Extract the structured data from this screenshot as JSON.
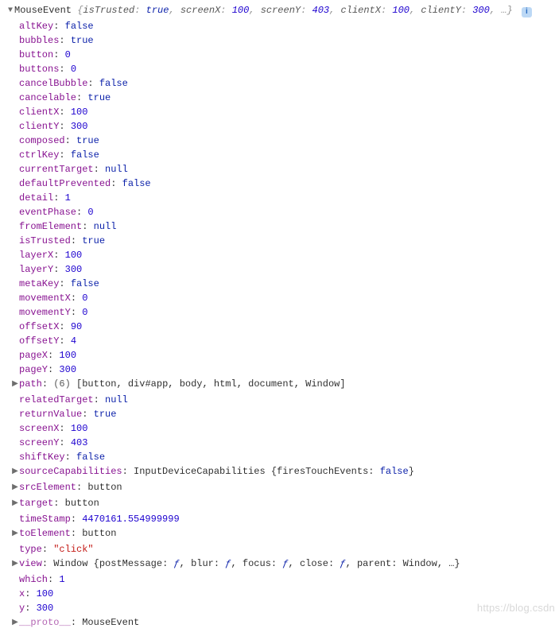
{
  "header": {
    "class_name": "MouseEvent",
    "summary": [
      {
        "k": "isTrusted",
        "v": "true",
        "cls": "bool"
      },
      {
        "k": "screenX",
        "v": "100",
        "cls": "num"
      },
      {
        "k": "screenY",
        "v": "403",
        "cls": "num"
      },
      {
        "k": "clientX",
        "v": "100",
        "cls": "num"
      },
      {
        "k": "clientY",
        "v": "300",
        "cls": "num"
      }
    ],
    "ellipsis": "…"
  },
  "props": [
    {
      "key": "altKey",
      "type": "bool",
      "value": "false"
    },
    {
      "key": "bubbles",
      "type": "bool",
      "value": "true"
    },
    {
      "key": "button",
      "type": "num",
      "value": "0"
    },
    {
      "key": "buttons",
      "type": "num",
      "value": "0"
    },
    {
      "key": "cancelBubble",
      "type": "bool",
      "value": "false"
    },
    {
      "key": "cancelable",
      "type": "bool",
      "value": "true"
    },
    {
      "key": "clientX",
      "type": "num",
      "value": "100"
    },
    {
      "key": "clientY",
      "type": "num",
      "value": "300"
    },
    {
      "key": "composed",
      "type": "bool",
      "value": "true"
    },
    {
      "key": "ctrlKey",
      "type": "bool",
      "value": "false"
    },
    {
      "key": "currentTarget",
      "type": "nul",
      "value": "null"
    },
    {
      "key": "defaultPrevented",
      "type": "bool",
      "value": "false"
    },
    {
      "key": "detail",
      "type": "num",
      "value": "1"
    },
    {
      "key": "eventPhase",
      "type": "num",
      "value": "0"
    },
    {
      "key": "fromElement",
      "type": "nul",
      "value": "null"
    },
    {
      "key": "isTrusted",
      "type": "bool",
      "value": "true"
    },
    {
      "key": "layerX",
      "type": "num",
      "value": "100"
    },
    {
      "key": "layerY",
      "type": "num",
      "value": "300"
    },
    {
      "key": "metaKey",
      "type": "bool",
      "value": "false"
    },
    {
      "key": "movementX",
      "type": "num",
      "value": "0"
    },
    {
      "key": "movementY",
      "type": "num",
      "value": "0"
    },
    {
      "key": "offsetX",
      "type": "num",
      "value": "90"
    },
    {
      "key": "offsetY",
      "type": "num",
      "value": "4"
    },
    {
      "key": "pageX",
      "type": "num",
      "value": "100"
    },
    {
      "key": "pageY",
      "type": "num",
      "value": "300"
    },
    {
      "key": "path",
      "type": "path",
      "expandable": true,
      "count": "(6)",
      "items": [
        "button",
        "div#app",
        "body",
        "html",
        "document",
        "Window"
      ]
    },
    {
      "key": "relatedTarget",
      "type": "nul",
      "value": "null"
    },
    {
      "key": "returnValue",
      "type": "bool",
      "value": "true"
    },
    {
      "key": "screenX",
      "type": "num",
      "value": "100"
    },
    {
      "key": "screenY",
      "type": "num",
      "value": "403"
    },
    {
      "key": "shiftKey",
      "type": "bool",
      "value": "false"
    },
    {
      "key": "sourceCapabilities",
      "type": "caps",
      "expandable": true,
      "class": "InputDeviceCapabilities",
      "inner_key": "firesTouchEvents",
      "inner_val": "false"
    },
    {
      "key": "srcElement",
      "type": "obj",
      "expandable": true,
      "value": "button"
    },
    {
      "key": "target",
      "type": "obj",
      "expandable": true,
      "value": "button"
    },
    {
      "key": "timeStamp",
      "type": "num",
      "value": "4470161.554999999"
    },
    {
      "key": "toElement",
      "type": "obj",
      "expandable": true,
      "value": "button"
    },
    {
      "key": "type",
      "type": "str",
      "value": "\"click\""
    },
    {
      "key": "view",
      "type": "view",
      "expandable": true,
      "class": "Window",
      "inner": [
        {
          "k": "postMessage",
          "v": "ƒ",
          "cls": "func"
        },
        {
          "k": "blur",
          "v": "ƒ",
          "cls": "func"
        },
        {
          "k": "focus",
          "v": "ƒ",
          "cls": "func"
        },
        {
          "k": "close",
          "v": "ƒ",
          "cls": "func"
        },
        {
          "k": "parent",
          "v": "Window",
          "cls": "plain"
        }
      ],
      "ellipsis": "…"
    },
    {
      "key": "which",
      "type": "num",
      "value": "1"
    },
    {
      "key": "x",
      "type": "num",
      "value": "100"
    },
    {
      "key": "y",
      "type": "num",
      "value": "300"
    },
    {
      "key": "__proto__",
      "type": "proto",
      "expandable": true,
      "value": "MouseEvent"
    }
  ],
  "watermark": "https://blog.csdn"
}
